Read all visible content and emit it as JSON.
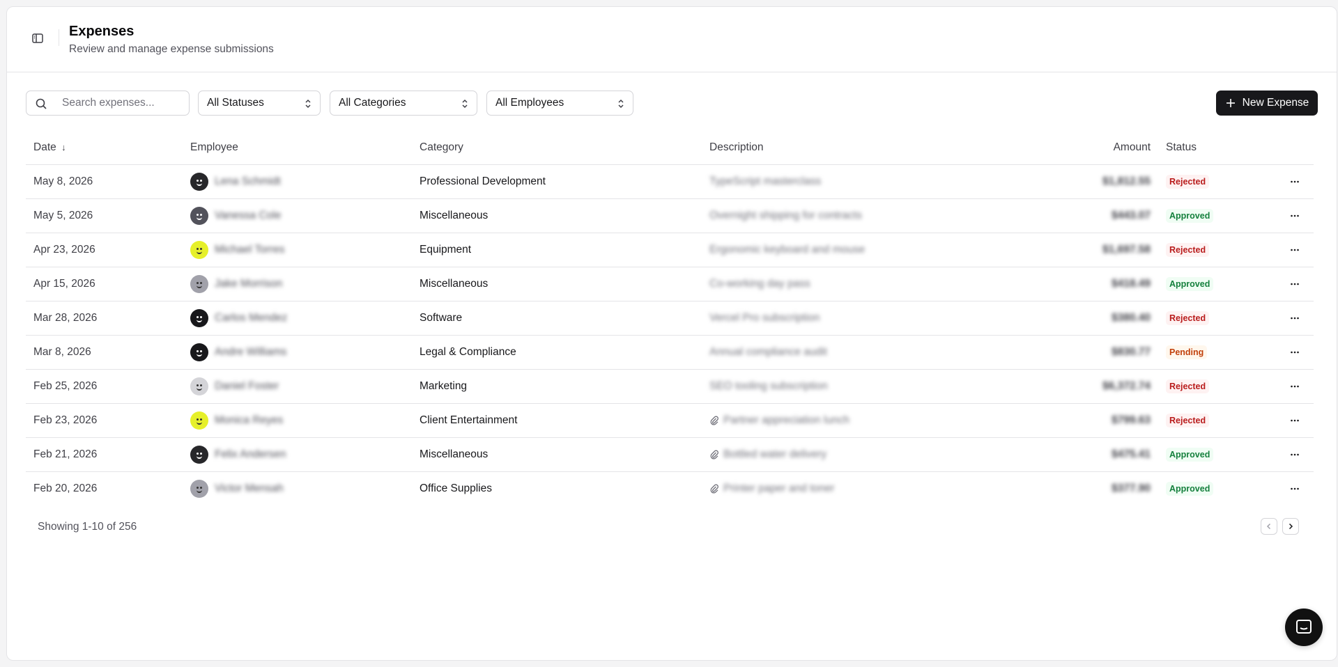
{
  "header": {
    "title": "Expenses",
    "subtitle": "Review and manage expense submissions"
  },
  "toolbar": {
    "search_placeholder": "Search expenses...",
    "status_filter": "All Statuses",
    "category_filter": "All Categories",
    "employee_filter": "All Employees",
    "new_button_label": "New Expense"
  },
  "table": {
    "columns": {
      "date": "Date",
      "employee": "Employee",
      "category": "Category",
      "description": "Description",
      "amount": "Amount",
      "status": "Status"
    },
    "sort_indicator": "↓",
    "rows": [
      {
        "date": "May 8, 2026",
        "employee": "Lena Schmidt",
        "avatar_color": "#27272a",
        "avatar_tone": "dark",
        "category": "Professional Development",
        "description": "TypeScript masterclass",
        "attachment": false,
        "amount": "$1,812.55",
        "status": "Rejected"
      },
      {
        "date": "May 5, 2026",
        "employee": "Vanessa Cole",
        "avatar_color": "#52525b",
        "avatar_tone": "dark",
        "category": "Miscellaneous",
        "description": "Overnight shipping for contracts",
        "attachment": false,
        "amount": "$443.07",
        "status": "Approved"
      },
      {
        "date": "Apr 23, 2026",
        "employee": "Michael Torres",
        "avatar_color": "#e6f02a",
        "avatar_tone": "light",
        "category": "Equipment",
        "description": "Ergonomic keyboard and mouse",
        "attachment": false,
        "amount": "$1,697.58",
        "status": "Rejected"
      },
      {
        "date": "Apr 15, 2026",
        "employee": "Jake Morrison",
        "avatar_color": "#a1a1aa",
        "avatar_tone": "light",
        "category": "Miscellaneous",
        "description": "Co-working day pass",
        "attachment": false,
        "amount": "$418.49",
        "status": "Approved"
      },
      {
        "date": "Mar 28, 2026",
        "employee": "Carlos Mendez",
        "avatar_color": "#18181b",
        "avatar_tone": "dark",
        "category": "Software",
        "description": "Vercel Pro subscription",
        "attachment": false,
        "amount": "$380.40",
        "status": "Rejected"
      },
      {
        "date": "Mar 8, 2026",
        "employee": "Andre Williams",
        "avatar_color": "#18181b",
        "avatar_tone": "dark",
        "category": "Legal & Compliance",
        "description": "Annual compliance audit",
        "attachment": false,
        "amount": "$830.77",
        "status": "Pending"
      },
      {
        "date": "Feb 25, 2026",
        "employee": "Daniel Foster",
        "avatar_color": "#d4d4d8",
        "avatar_tone": "light",
        "category": "Marketing",
        "description": "SEO tooling subscription",
        "attachment": false,
        "amount": "$6,372.74",
        "status": "Rejected"
      },
      {
        "date": "Feb 23, 2026",
        "employee": "Monica Reyes",
        "avatar_color": "#e6f02a",
        "avatar_tone": "light",
        "category": "Client Entertainment",
        "description": "Partner appreciation lunch",
        "attachment": true,
        "amount": "$799.63",
        "status": "Rejected"
      },
      {
        "date": "Feb 21, 2026",
        "employee": "Felix Andersen",
        "avatar_color": "#27272a",
        "avatar_tone": "dark",
        "category": "Miscellaneous",
        "description": "Bottled water delivery",
        "attachment": true,
        "amount": "$475.41",
        "status": "Approved"
      },
      {
        "date": "Feb 20, 2026",
        "employee": "Victor Mensah",
        "avatar_color": "#a1a1aa",
        "avatar_tone": "light",
        "category": "Office Supplies",
        "description": "Printer paper and toner",
        "attachment": true,
        "amount": "$377.90",
        "status": "Approved"
      }
    ]
  },
  "status_styles": {
    "Rejected": {
      "bg": "#fef2f2",
      "fg": "#b91c1c"
    },
    "Approved": {
      "bg": "#f0fdf4",
      "fg": "#15803d"
    },
    "Pending": {
      "bg": "#fff7ed",
      "fg": "#c2410c"
    }
  },
  "footer": {
    "showing_text": "Showing 1-10 of 256"
  },
  "icons": {
    "sidebar_toggle": "panel-left-icon",
    "search": "search-icon",
    "select": "chevrons-up-down-icon",
    "new": "plus-icon",
    "attachment": "paperclip-icon",
    "row_actions": "more-horizontal-icon",
    "prev": "chevron-left-icon",
    "next": "chevron-right-icon",
    "chat": "chat-bubble-icon"
  }
}
